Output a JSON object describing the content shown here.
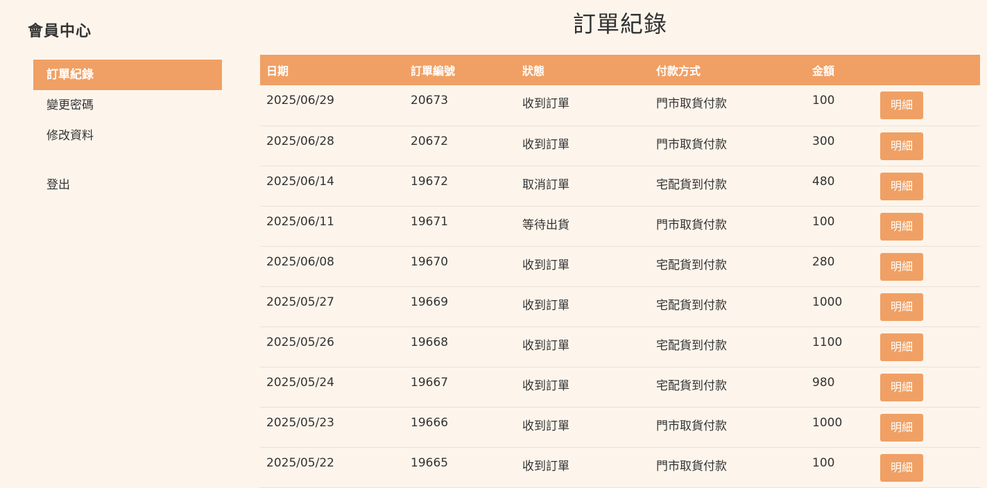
{
  "sidebar": {
    "title": "會員中心",
    "items": [
      {
        "label": "訂單紀錄",
        "active": true
      },
      {
        "label": "變更密碼",
        "active": false
      },
      {
        "label": "修改資料",
        "active": false
      }
    ],
    "logout_label": "登出"
  },
  "main": {
    "title": "訂單紀錄",
    "columns": [
      "日期",
      "訂單編號",
      "狀態",
      "付款方式",
      "金額",
      ""
    ],
    "detail_label": "明細",
    "rows": [
      {
        "date": "2025/06/29",
        "order_no": "20673",
        "status": "收到訂單",
        "payment": "門市取貨付款",
        "amount": "100"
      },
      {
        "date": "2025/06/28",
        "order_no": "20672",
        "status": "收到訂單",
        "payment": "門市取貨付款",
        "amount": "300"
      },
      {
        "date": "2025/06/14",
        "order_no": "19672",
        "status": "取消訂單",
        "payment": "宅配貨到付款",
        "amount": "480"
      },
      {
        "date": "2025/06/11",
        "order_no": "19671",
        "status": "等待出貨",
        "payment": "門市取貨付款",
        "amount": "100"
      },
      {
        "date": "2025/06/08",
        "order_no": "19670",
        "status": "收到訂單",
        "payment": "宅配貨到付款",
        "amount": "280"
      },
      {
        "date": "2025/05/27",
        "order_no": "19669",
        "status": "收到訂單",
        "payment": "宅配貨到付款",
        "amount": "1000"
      },
      {
        "date": "2025/05/26",
        "order_no": "19668",
        "status": "收到訂單",
        "payment": "宅配貨到付款",
        "amount": "1100"
      },
      {
        "date": "2025/05/24",
        "order_no": "19667",
        "status": "收到訂單",
        "payment": "宅配貨到付款",
        "amount": "980"
      },
      {
        "date": "2025/05/23",
        "order_no": "19666",
        "status": "收到訂單",
        "payment": "門市取貨付款",
        "amount": "1000"
      },
      {
        "date": "2025/05/22",
        "order_no": "19665",
        "status": "收到訂單",
        "payment": "門市取貨付款",
        "amount": "100"
      }
    ]
  },
  "colors": {
    "accent": "#f0a064",
    "background": "#fdf5ec",
    "text": "#333333"
  }
}
